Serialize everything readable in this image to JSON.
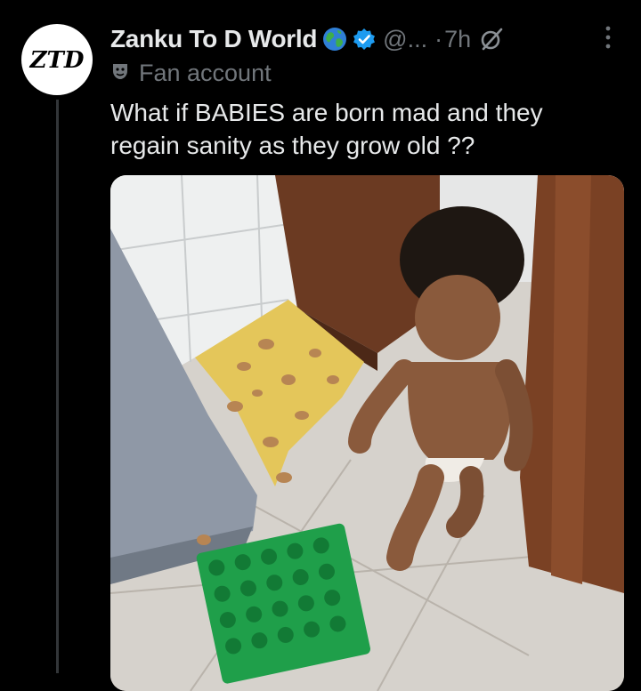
{
  "tweet": {
    "display_name": "Zanku To D World",
    "handle": "@...",
    "separator": "·",
    "time": "7h",
    "label": "Fan account",
    "text": "What if BABIES are born mad and they regain sanity as they grow old ??",
    "avatar_text": "ZTD"
  },
  "icons": {
    "globe": "globe-emoji-icon",
    "verified": "verified-badge-icon",
    "grok": "grok-icon",
    "more": "more-options-icon",
    "fan": "fan-account-mask-icon"
  },
  "colors": {
    "background": "#000000",
    "text_primary": "#e7e9ea",
    "text_secondary": "#71767b",
    "verified_blue": "#1d9bf0"
  },
  "media": {
    "description_alt": ""
  }
}
